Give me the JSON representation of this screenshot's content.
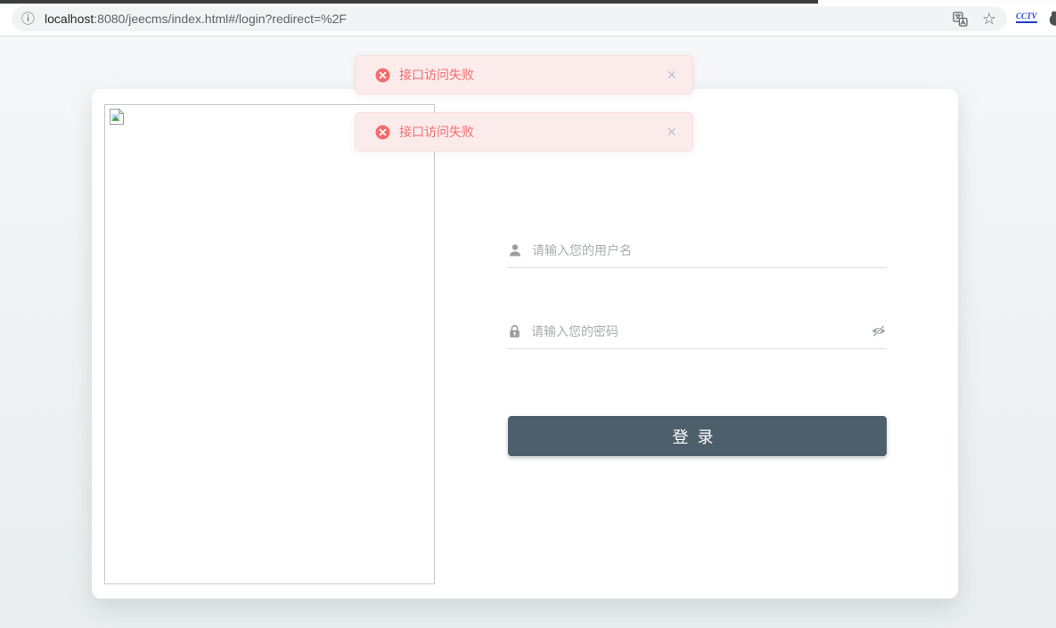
{
  "browser": {
    "url_host": "localhost",
    "url_rest": ":8080/jeecms/index.html#/login?redirect=%2F",
    "extension_label": "CCTV"
  },
  "icons": {
    "info": "ⓘ",
    "star": "☆",
    "close": "×"
  },
  "toasts": [
    {
      "message": "接口访问失败"
    },
    {
      "message": "接口访问失败"
    }
  ],
  "login_form": {
    "username_placeholder": "请输入您的用户名",
    "password_placeholder": "请输入您的密码",
    "login_button_label": "登录"
  },
  "colors": {
    "toast_bg": "#fcebeb",
    "toast_text": "#f56c6c",
    "button_bg": "#4d5f6a",
    "omnibox_bg": "#f1f3f4",
    "page_bg": "#edf0f1"
  }
}
